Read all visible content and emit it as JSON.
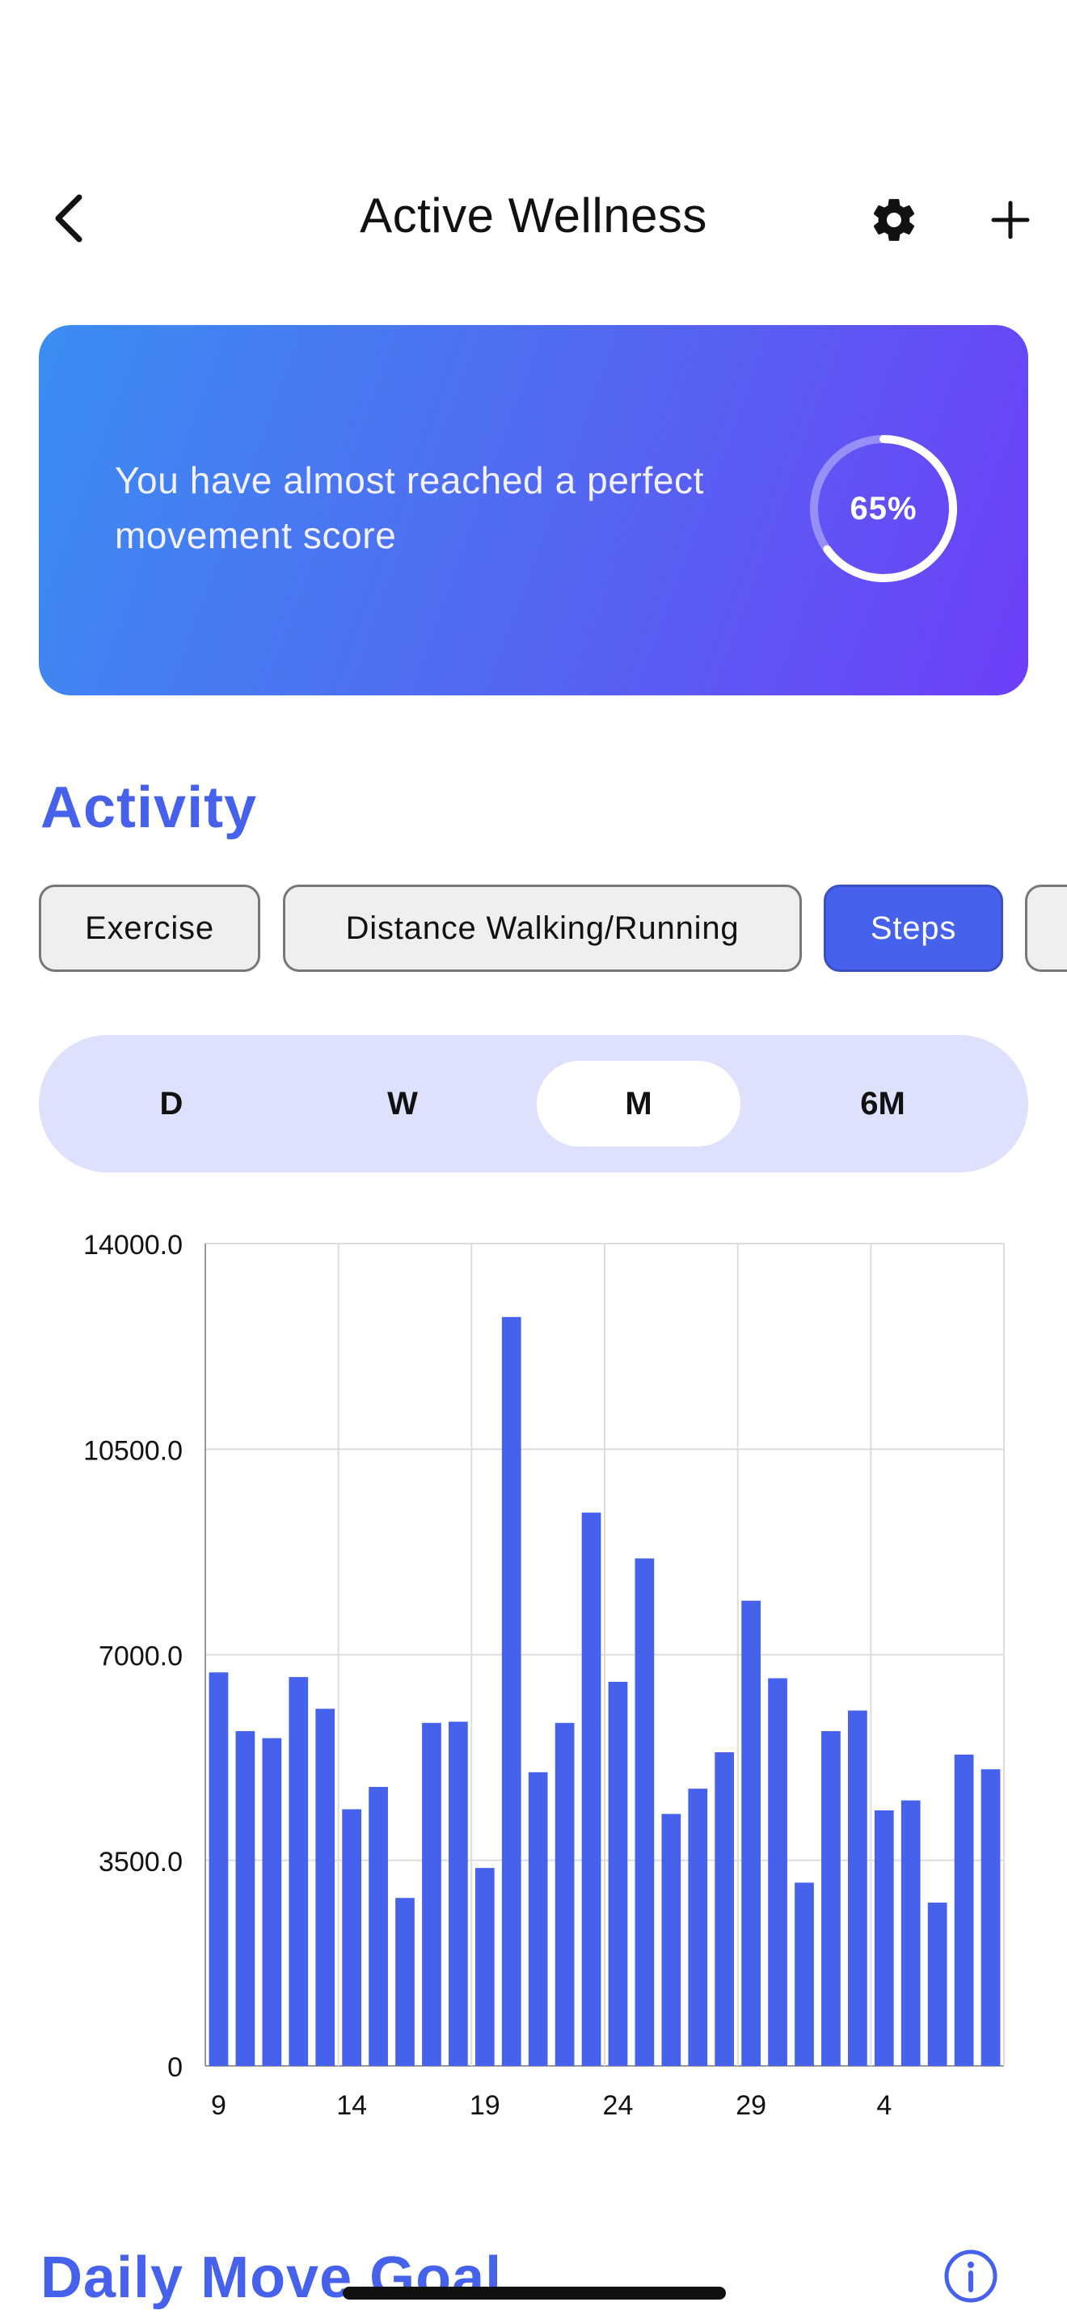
{
  "header": {
    "title": "Active Wellness",
    "back_icon": "chevron-left-icon",
    "settings_icon": "gear-icon",
    "add_icon": "plus-icon"
  },
  "banner": {
    "message": "You have almost reached a perfect movement score",
    "progress_label": "65%",
    "progress": 0.65,
    "gradient_from": "#3b8df2",
    "gradient_to": "#6e3ef8"
  },
  "activity": {
    "title": "Activity",
    "chips": [
      {
        "label": "Exercise",
        "active": false
      },
      {
        "label": "Distance Walking/Running",
        "active": false
      },
      {
        "label": "Steps",
        "active": true
      }
    ],
    "accent": "#4661ec"
  },
  "ranges": [
    {
      "label": "D",
      "active": false
    },
    {
      "label": "W",
      "active": false
    },
    {
      "label": "M",
      "active": true
    },
    {
      "label": "6M",
      "active": false
    }
  ],
  "chart_data": {
    "type": "bar",
    "series": [
      {
        "values": [
          6700,
          5700,
          5580,
          6620,
          6080,
          4370,
          4750,
          2860,
          5840,
          5860,
          3370,
          12750,
          5000,
          5840,
          9420,
          6540,
          8640,
          4290,
          4720,
          5340,
          7920,
          6600,
          3120,
          5700,
          6050,
          4350,
          4520,
          2780,
          5300,
          5050
        ]
      }
    ],
    "x_tick_labels": [
      "9",
      "14",
      "19",
      "24",
      "29",
      "4"
    ],
    "y_tick_labels": [
      "0",
      "3500.0",
      "7000.0",
      "10500.0",
      "14000.0"
    ],
    "ylim": [
      0,
      14000
    ],
    "grid": true,
    "color": "#4661ec"
  },
  "goal": {
    "title": "Daily Move Goal",
    "info_icon": "info-icon"
  }
}
